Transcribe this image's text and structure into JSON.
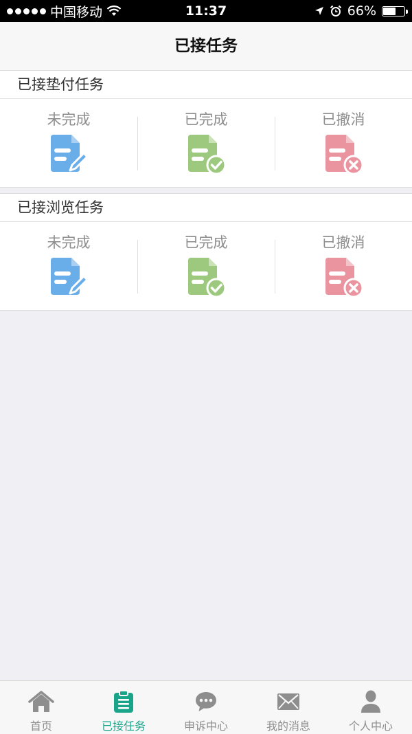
{
  "status_bar": {
    "carrier": "中国移动",
    "time": "11:37",
    "battery_percent": "66%",
    "battery_level": 0.66
  },
  "nav": {
    "title": "已接任务"
  },
  "sections": [
    {
      "title": "已接垫付任务",
      "items": [
        {
          "label": "未完成",
          "icon": "doc-edit-icon",
          "color": "#6aaee9"
        },
        {
          "label": "已完成",
          "icon": "doc-check-icon",
          "color": "#9cc97d"
        },
        {
          "label": "已撤消",
          "icon": "doc-cancel-icon",
          "color": "#e9949f"
        }
      ]
    },
    {
      "title": "已接浏览任务",
      "items": [
        {
          "label": "未完成",
          "icon": "doc-edit-icon",
          "color": "#6aaee9"
        },
        {
          "label": "已完成",
          "icon": "doc-check-icon",
          "color": "#9cc97d"
        },
        {
          "label": "已撤消",
          "icon": "doc-cancel-icon",
          "color": "#e9949f"
        }
      ]
    }
  ],
  "tabs": [
    {
      "label": "首页",
      "icon": "home-icon",
      "active": false
    },
    {
      "label": "已接任务",
      "icon": "clipboard-icon",
      "active": true
    },
    {
      "label": "申诉中心",
      "icon": "chat-icon",
      "active": false
    },
    {
      "label": "我的消息",
      "icon": "mail-icon",
      "active": false
    },
    {
      "label": "个人中心",
      "icon": "person-icon",
      "active": false
    }
  ],
  "colors": {
    "accent": "#1aa58a",
    "inactive_tab": "#8e8e8e",
    "background": "#efeff4"
  }
}
